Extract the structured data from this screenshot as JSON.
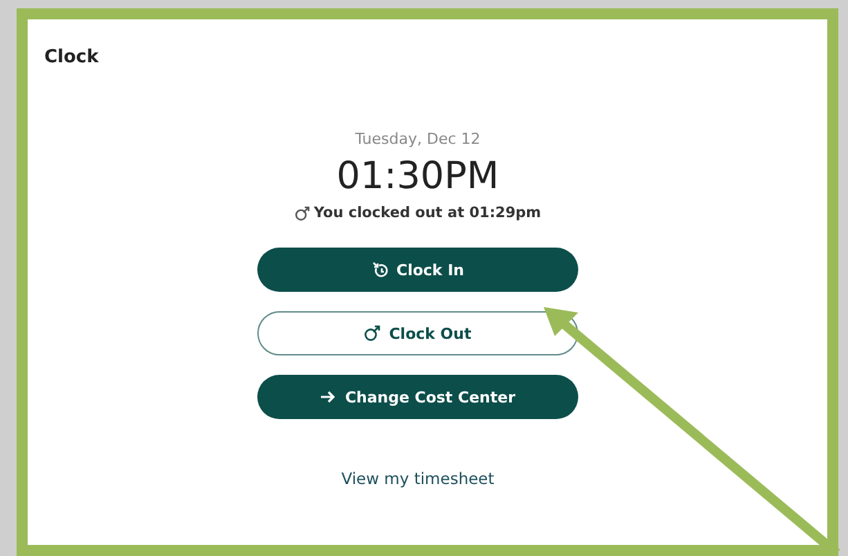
{
  "card": {
    "title": "Clock"
  },
  "clock": {
    "date": "Tuesday, Dec 12",
    "time": "01:30PM",
    "status": "You clocked out at 01:29pm"
  },
  "buttons": [
    {
      "label": "Clock In",
      "kind": "primary"
    },
    {
      "label": "Clock Out",
      "kind": "secondary"
    },
    {
      "label": "Change Cost Center",
      "kind": "primary"
    }
  ],
  "link": "View my timesheet"
}
